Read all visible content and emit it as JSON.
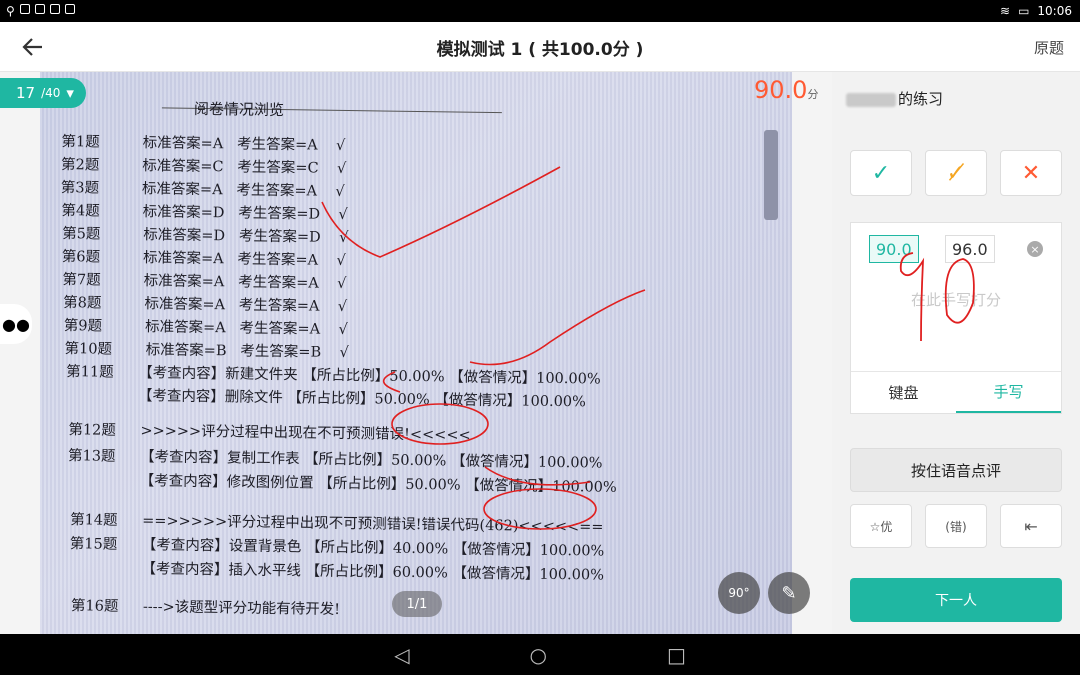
{
  "status": {
    "time": "10:06"
  },
  "header": {
    "title": "模拟测试 1 ( 共100.0分 )",
    "right_link": "原题"
  },
  "viewer": {
    "page_current": "17",
    "page_total": "/40",
    "score_value": "90.0",
    "score_unit": "分",
    "image_pager": "1/1",
    "rotate_label": "90°",
    "sheet": {
      "title": "阅卷情况浏览",
      "rows": [
        {
          "q": "第1题",
          "text": "  标准答案=A   考生答案=A    √"
        },
        {
          "q": "第2题",
          "text": "  标准答案=C   考生答案=C    √"
        },
        {
          "q": "第3题",
          "text": "  标准答案=A   考生答案=A    √"
        },
        {
          "q": "第4题",
          "text": "  标准答案=D   考生答案=D    √"
        },
        {
          "q": "第5题",
          "text": "  标准答案=D   考生答案=D    √"
        },
        {
          "q": "第6题",
          "text": "  标准答案=A   考生答案=A    √"
        },
        {
          "q": "第7题",
          "text": "  标准答案=A   考生答案=A    √"
        },
        {
          "q": "第8题",
          "text": "  标准答案=A   考生答案=A    √"
        },
        {
          "q": "第9题",
          "text": "  标准答案=A   考生答案=A    √"
        },
        {
          "q": "第10题",
          "text": "  标准答案=B   考生答案=B    √"
        },
        {
          "q": "第11题",
          "text": "【考查内容】新建文件夹 【所占比例】50.00% 【做答情况】100.00%"
        },
        {
          "q": "",
          "text": "【考查内容】删除文件 【所占比例】50.00% 【做答情况】100.00%"
        },
        {
          "q": "第12题",
          "text": ">>>>>评分过程中出现在不可预测错误!<<<<<"
        },
        {
          "q": "第13题",
          "text": "【考查内容】复制工作表 【所占比例】50.00% 【做答情况】100.00%"
        },
        {
          "q": "",
          "text": "【考查内容】修改图例位置 【所占比例】50.00% 【做答情况】100.00%"
        },
        {
          "q": "第14题",
          "text": "==>>>>>评分过程中出现不可预测错误!错误代码(462)<<<<<=="
        },
        {
          "q": "第15题",
          "text": "【考查内容】设置背景色 【所占比例】40.00% 【做答情况】100.00%"
        },
        {
          "q": "",
          "text": "【考查内容】插入水平线 【所占比例】60.00% 【做答情况】100.00%"
        },
        {
          "q": "第16题",
          "text": "---->该题型评分功能有待开发!"
        }
      ]
    }
  },
  "panel": {
    "student_suffix": "的练习",
    "score_selected": "90.0",
    "score_alt": "96.0",
    "handwrite_hint": "在此手写打分",
    "tab_keyboard": "键盘",
    "tab_handwrite": "手写",
    "voice_button": "按住语音点评",
    "tool_excellent": "优",
    "tool_error": "错",
    "next_button": "下一人"
  },
  "colors": {
    "accent": "#1fb7a2",
    "score": "#ff5a33",
    "half": "#f5a623",
    "wrong": "#ff5a33",
    "pen": "#e02020"
  }
}
